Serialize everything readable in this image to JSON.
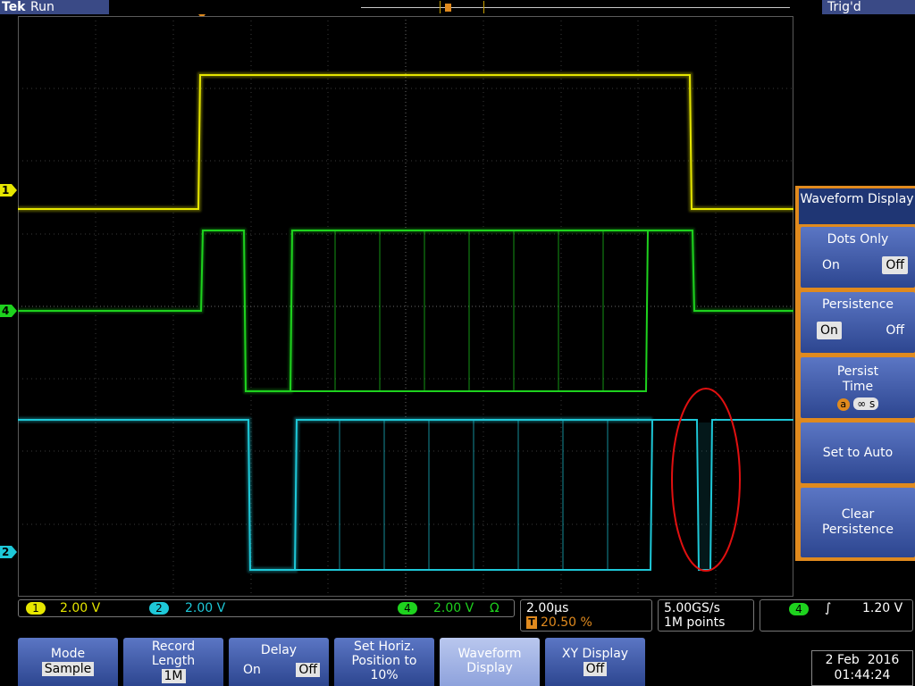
{
  "header": {
    "brand": "Tek",
    "run_state": "Run",
    "trigger_state": "Trig'd"
  },
  "markers": {
    "trigger_t": "T",
    "ch1": "1",
    "ch4": "4",
    "ch2": "2"
  },
  "colors": {
    "ch1": "#e6e600",
    "ch2": "#1ec8d8",
    "ch4": "#1ed21e",
    "accent": "#e08a1e",
    "annotation": "#e01010"
  },
  "side_menu": {
    "title": "Waveform Display",
    "dots_only": {
      "label": "Dots Only",
      "on": "On",
      "off": "Off",
      "selected": "off"
    },
    "persistence": {
      "label": "Persistence",
      "on": "On",
      "off": "Off",
      "selected": "on"
    },
    "persist_time": {
      "label": "Persist Time",
      "knob": "a",
      "value": "∞ s"
    },
    "set_to_auto": "Set to Auto",
    "clear_persistence": "Clear Persistence"
  },
  "readouts": {
    "ch1": {
      "num": "1",
      "scale": "2.00 V"
    },
    "ch2": {
      "num": "2",
      "scale": "2.00 V"
    },
    "ch4": {
      "num": "4",
      "scale": "2.00 V",
      "coupling": "Ω"
    },
    "timebase": {
      "per_div": "2.00µs",
      "trig_icon": "T",
      "position": "20.50 %"
    },
    "sample": {
      "rate": "5.00GS/s",
      "points": "1M points"
    },
    "trigger": {
      "num": "4",
      "slope": "∫",
      "level": "1.20 V"
    }
  },
  "bottom_menu": [
    {
      "label": "Mode",
      "value": "Sample"
    },
    {
      "label": "Record Length",
      "value": "1M"
    },
    {
      "label": "Delay",
      "on": "On",
      "off": "Off",
      "selected": "off"
    },
    {
      "label": "Set Horiz. Position to 10%"
    },
    {
      "label": "Waveform Display"
    },
    {
      "label": "XY Display",
      "value": "Off"
    }
  ],
  "clock": {
    "date": "2 Feb  2016",
    "time": "01:44:24"
  }
}
